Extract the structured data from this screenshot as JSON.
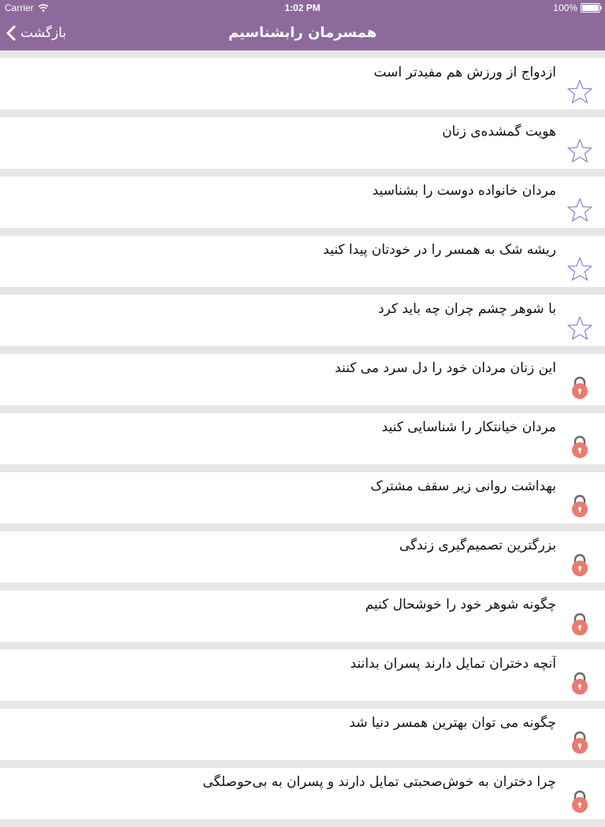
{
  "status_bar": {
    "carrier": "Carrier",
    "time": "1:02 PM",
    "battery": "100%"
  },
  "nav": {
    "back_label": "بازگشت",
    "title": "همسرمان رابشناسیم"
  },
  "colors": {
    "header": "#8d6a9b",
    "star_outline": "#8a7fd8",
    "lock": "#ec7b6f"
  },
  "items": [
    {
      "title": "ازدواج از ورزش هم مفیدتر است",
      "icon": "star-outline-icon"
    },
    {
      "title": "هویت گمشده‌ی زنان",
      "icon": "star-outline-icon"
    },
    {
      "title": "مردان خانواده دوست را بشناسید",
      "icon": "star-outline-icon"
    },
    {
      "title": "ریشه شک به همسر را در خودتان پیدا کنید",
      "icon": "star-outline-icon"
    },
    {
      "title": "با شوهر چشم چران چه باید کرد",
      "icon": "star-outline-icon"
    },
    {
      "title": "این زنان مردان خود را دل سرد می کنند",
      "icon": "lock-icon"
    },
    {
      "title": "مردان خیانتکار را شناسایی کنید",
      "icon": "lock-icon"
    },
    {
      "title": "بهداشت روانی زیر سقف مشترک",
      "icon": "lock-icon"
    },
    {
      "title": "بزرگترین تصمیم‌گیری زندگی",
      "icon": "lock-icon"
    },
    {
      "title": "چگونه شوهر خود را خوشحال کنیم",
      "icon": "lock-icon"
    },
    {
      "title": "آنچه دختران تمایل دارند پسران بدانند",
      "icon": "lock-icon"
    },
    {
      "title": "چگونه می توان بهترین همسر دنیا شد",
      "icon": "lock-icon"
    },
    {
      "title": "چرا دختران به خوش‌صحبتی تمایل دارند و پسران به بی‌حوصلگی",
      "icon": "lock-icon"
    }
  ]
}
